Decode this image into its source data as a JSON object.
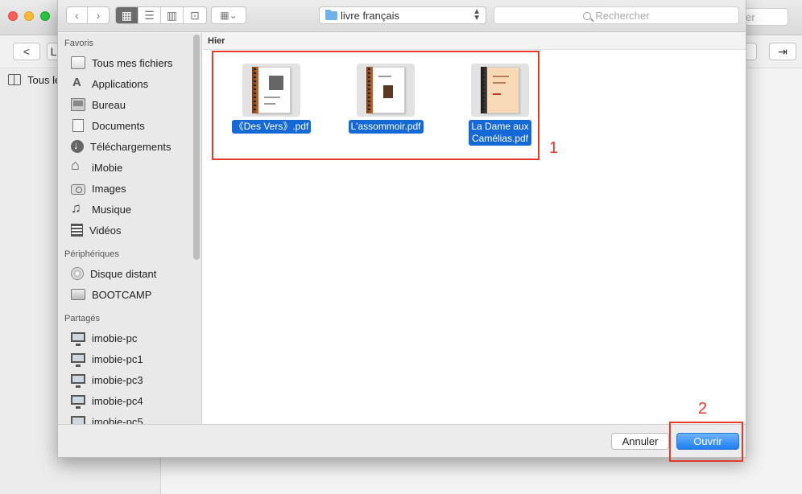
{
  "background_app": {
    "search_placeholder": "er",
    "back_button": "<",
    "partial_button": "L",
    "sidebar_item": "Tous le"
  },
  "dialog": {
    "toolbar": {
      "back_glyph": "‹",
      "forward_glyph": "›",
      "view_icon_glyph": "▦",
      "view_list_glyph": "☰",
      "view_columns_glyph": "▥",
      "view_coverflow_glyph": "⊡",
      "arrange_glyph": "▦⌄",
      "location": "livre français",
      "search_placeholder": "Rechercher"
    },
    "sidebar": {
      "sections": [
        {
          "title": "Favoris",
          "items": [
            {
              "label": "Tous mes fichiers",
              "icon": "all-files-icon"
            },
            {
              "label": "Applications",
              "icon": "applications-icon"
            },
            {
              "label": "Bureau",
              "icon": "desktop-icon"
            },
            {
              "label": "Documents",
              "icon": "documents-icon"
            },
            {
              "label": "Téléchargements",
              "icon": "downloads-icon"
            },
            {
              "label": "iMobie",
              "icon": "home-icon"
            },
            {
              "label": "Images",
              "icon": "camera-icon"
            },
            {
              "label": "Musique",
              "icon": "music-icon"
            },
            {
              "label": "Vidéos",
              "icon": "film-icon"
            }
          ]
        },
        {
          "title": "Périphériques",
          "items": [
            {
              "label": "Disque distant",
              "icon": "disc-icon"
            },
            {
              "label": "BOOTCAMP",
              "icon": "drive-icon"
            }
          ]
        },
        {
          "title": "Partagés",
          "items": [
            {
              "label": "imobie-pc",
              "icon": "computer-icon"
            },
            {
              "label": "imobie-pc1",
              "icon": "computer-icon"
            },
            {
              "label": "imobie-pc3",
              "icon": "computer-icon"
            },
            {
              "label": "imobie-pc4",
              "icon": "computer-icon"
            },
            {
              "label": "imobie-pc5",
              "icon": "computer-icon"
            }
          ]
        }
      ]
    },
    "files": {
      "group_header": "Hier",
      "items": [
        {
          "name": "《Des Vers》.pdf",
          "selected": true
        },
        {
          "name": "L'assommoir.pdf",
          "selected": true
        },
        {
          "name_line1": "La Dame aux",
          "name_line2": "Camélias.pdf",
          "selected": true
        }
      ]
    },
    "buttons": {
      "cancel": "Annuler",
      "open": "Ouvrir"
    }
  },
  "annotations": {
    "label1": "1",
    "label2": "2",
    "color": "#e43a2a"
  },
  "colors": {
    "selection": "#1569d6",
    "primary_button": "#1f7ef2"
  }
}
